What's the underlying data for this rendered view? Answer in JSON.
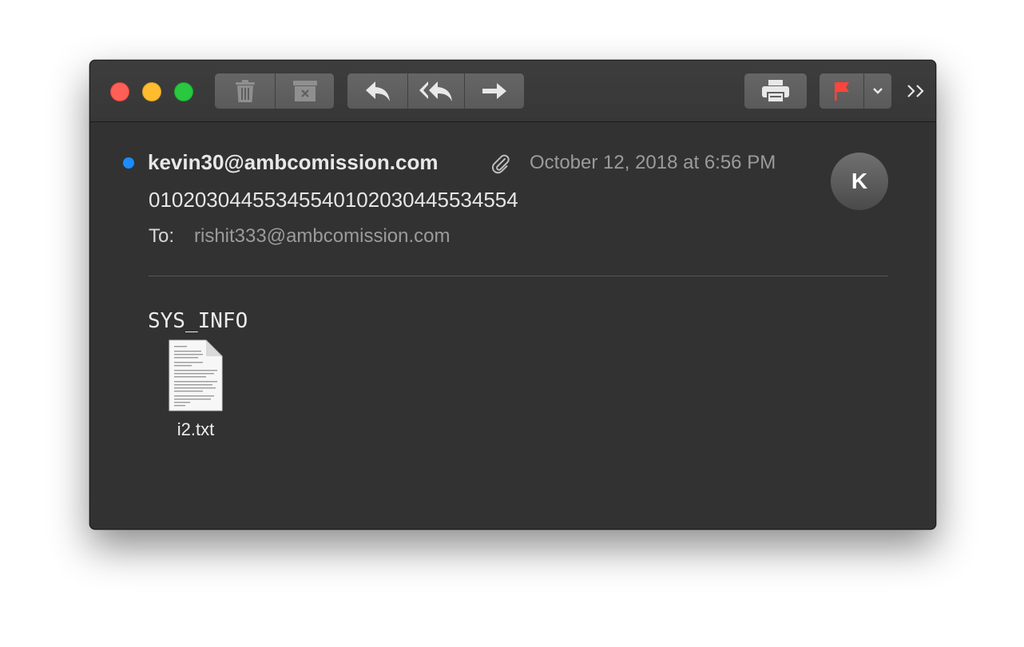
{
  "toolbar": {
    "buttons": [
      {
        "name": "delete",
        "icon": "trash-icon"
      },
      {
        "name": "junk",
        "icon": "junk-icon"
      },
      {
        "name": "reply",
        "icon": "reply-icon"
      },
      {
        "name": "reply-all",
        "icon": "reply-all-icon"
      },
      {
        "name": "forward",
        "icon": "forward-icon"
      },
      {
        "name": "print",
        "icon": "printer-icon"
      },
      {
        "name": "flag",
        "icon": "flag-icon"
      },
      {
        "name": "flag-menu",
        "icon": "chevron-down-icon"
      },
      {
        "name": "overflow",
        "icon": "chevrons-right-icon"
      }
    ],
    "flag_color": "#ff453a"
  },
  "message": {
    "sender": "kevin30@ambcomission.com",
    "date": "October 12, 2018 at 6:56 PM",
    "avatar_initial": "K",
    "subject": "01020304455345540102030445534554",
    "to_label": "To:",
    "to_value": "rishit333@ambcomission.com",
    "body": "SYS_INFO",
    "attachment": {
      "name": "i2.txt",
      "icon": "text-document-icon"
    },
    "unread_color": "#1a8cff"
  }
}
